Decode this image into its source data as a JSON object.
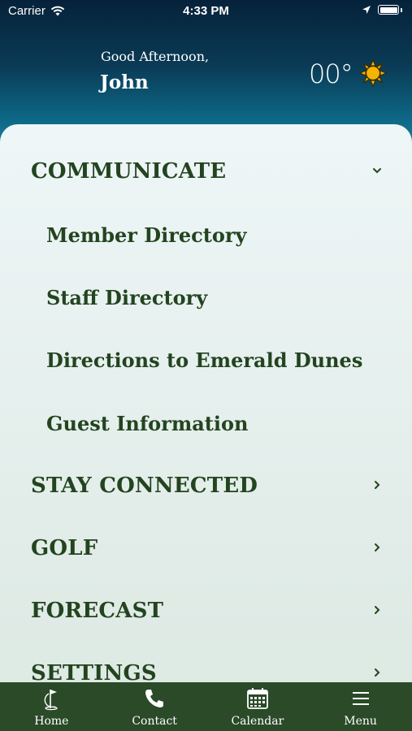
{
  "status": {
    "carrier": "Carrier",
    "time": "4:33 PM"
  },
  "header": {
    "greeting": "Good Afternoon,",
    "name": "John",
    "temperature": "00°",
    "weather_icon": "sun-icon"
  },
  "menu": {
    "communicate": "COMMUNICATE",
    "member_directory": "Member Directory",
    "staff_directory": "Staff Directory",
    "directions": "Directions to Emerald Dunes",
    "guest_information": "Guest Information",
    "stay_connected": "STAY CONNECTED",
    "golf": "GOLF",
    "forecast": "FORECAST",
    "settings": "SETTINGS"
  },
  "tabs": {
    "home": "Home",
    "contact": "Contact",
    "calendar": "Calendar",
    "menu": "Menu"
  },
  "colors": {
    "text_green": "#23441f",
    "tabbar_bg": "#2a4a28",
    "sun_fill": "#f5b400"
  }
}
